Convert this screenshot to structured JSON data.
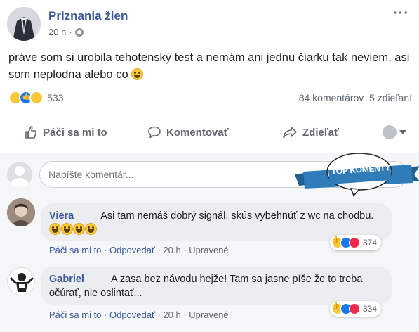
{
  "post": {
    "page_name": "Priznania žien",
    "time": "20 h",
    "text": "práve som si urobila tehotenský test a nemám ani jednu čiarku tak neviem, asi som neplodna alebo co",
    "reaction_count": "533",
    "comments_count": "84 komentárov",
    "shares_count": "5 zdieľaní"
  },
  "actions": {
    "like": "Páči sa mi to",
    "comment": "Komentovať",
    "share": "Zdieľať"
  },
  "comment_input": {
    "placeholder": "Napíšte komentár..."
  },
  "badge": {
    "text": "TOP KOMENTY"
  },
  "comments": [
    {
      "author": "Viera",
      "text": "Asi tam nemáš dobrý signál, skús vybehnúť z wc na chodbu.",
      "like_label": "Páči sa mi to",
      "reply_label": "Odpovedať",
      "time": "20 h",
      "edited": "Upravené",
      "reactions": "374"
    },
    {
      "author": "Gabriel",
      "text": "A zasa bez návodu hejže! Tam sa jasne píše že to treba očúrať, nie oslintať...",
      "like_label": "Páči sa mi to",
      "reply_label": "Odpovedať",
      "time": "20 h",
      "edited": "Upravené",
      "reactions": "334"
    }
  ],
  "colors": {
    "link": "#385898",
    "badge": "#2f7cb8"
  }
}
